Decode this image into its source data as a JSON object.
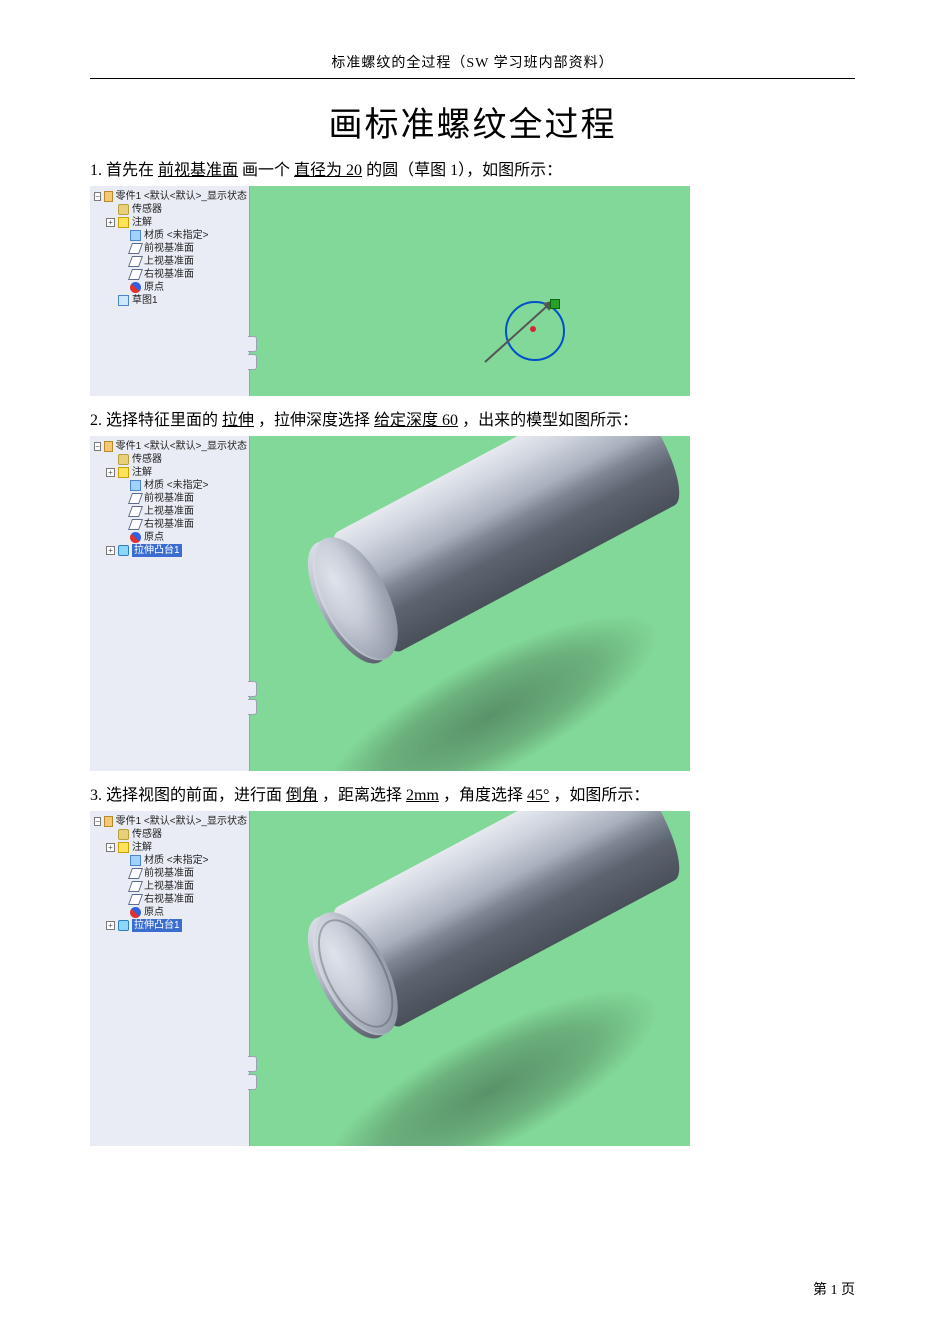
{
  "header": "标准螺纹的全过程（SW  学习班内部资料）",
  "title": "画标准螺纹全过程",
  "step1": {
    "num": "1.",
    "t1": "首先在",
    "u1": "前视基准面",
    "t2": "画一个",
    "u2": "直径为 20",
    "t3": " 的圆（草图 1），如图所示："
  },
  "step2": {
    "num": "2.",
    "t1": "选择特征里面的",
    "u1": "拉伸",
    "t2": "，拉伸深度选择",
    "u2": "给定深度 60",
    "t3": "，出来的模型如图所示："
  },
  "step3": {
    "num": "3.",
    "t1": "选择视图的前面，进行面",
    "u1": "倒角",
    "t2": "，距离选择 ",
    "u2": "2mm",
    "t3": "，角度选择 ",
    "u3": "45°",
    "t4": " ，如图所示："
  },
  "tree1": {
    "root": "零件1  <默认<默认>_显示状态",
    "sensor": "传感器",
    "annot": "注解",
    "mat": "材质 <未指定>",
    "pfront": "前视基准面",
    "ptop": "上视基准面",
    "pright": "右视基准面",
    "origin": "原点",
    "sketch": "草图1"
  },
  "tree2": {
    "root": "零件1  <默认<默认>_显示状态",
    "sensor": "传感器",
    "annot": "注解",
    "mat": "材质 <未指定>",
    "pfront": "前视基准面",
    "ptop": "上视基准面",
    "pright": "右视基准面",
    "origin": "原点",
    "feat": "拉伸凸台1"
  },
  "tree3": {
    "root": "零件1  <默认<默认>_显示状态",
    "sensor": "传感器",
    "annot": "注解",
    "mat": "材质 <未指定>",
    "pfront": "前视基准面",
    "ptop": "上视基准面",
    "pright": "右视基准面",
    "origin": "原点",
    "feat": "拉伸凸台1"
  },
  "footer": {
    "page": "第 1 页"
  }
}
